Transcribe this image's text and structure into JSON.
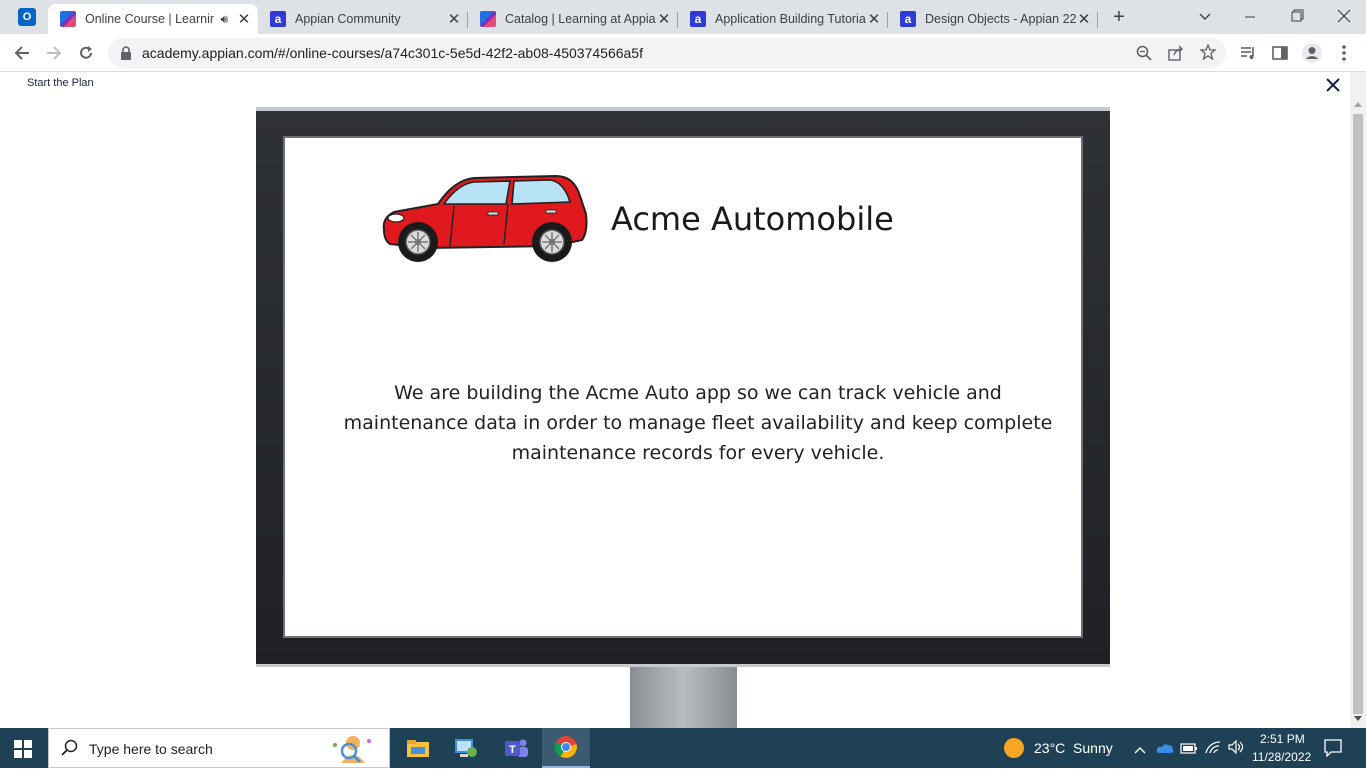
{
  "browser": {
    "tabs": [
      {
        "label": "Online Course | Learnin",
        "favicon": "appian-course-icon",
        "audio": true,
        "active": true
      },
      {
        "label": "Appian Community",
        "favicon": "appian-icon",
        "active": false
      },
      {
        "label": "Catalog | Learning at Appia",
        "favicon": "appian-course-icon",
        "active": false
      },
      {
        "label": "Application Building Tutoria",
        "favicon": "appian-icon",
        "active": false
      },
      {
        "label": "Design Objects - Appian 22",
        "favicon": "appian-icon",
        "active": false
      }
    ],
    "url": "academy.appian.com/#/online-courses/a74c301c-5e5d-42f2-ab08-450374566a5f"
  },
  "page": {
    "header_label": "Start the Plan",
    "slide": {
      "title": "Acme Automobile",
      "body_lines": [
        "We are building the Acme Auto app so we can track vehicle and",
        "maintenance data in order to manage fleet availability and keep complete",
        "maintenance records for every vehicle."
      ]
    }
  },
  "taskbar": {
    "search_placeholder": "Type here to search",
    "weather": "23°C  Sunny",
    "time": "2:51 PM",
    "date": "11/28/2022"
  },
  "colors": {
    "car_red": "#e0191f",
    "taskbar": "#1e4156",
    "monitor_frame": "#25272b"
  }
}
